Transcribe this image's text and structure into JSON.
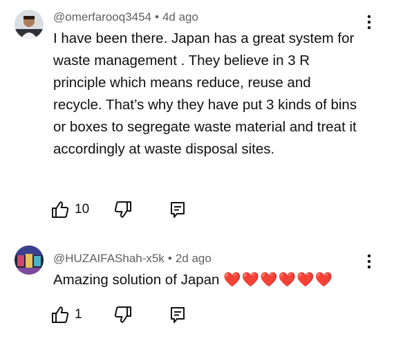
{
  "comments": [
    {
      "author": "@omerfarooq3454",
      "separator": "•",
      "time": "4d ago",
      "text": "I have been there. Japan has a great system for waste management . They believe in 3 R principle which means reduce, reuse and recycle. That’s why they have put 3 kinds of bins or boxes to segregate waste material and treat it accordingly at waste disposal sites.",
      "likes": "10",
      "icons": [
        "avatar",
        "like-icon",
        "dislike-icon",
        "reply-icon",
        "more-vert-icon"
      ]
    },
    {
      "author": "@HUZAIFAShah-x5k",
      "separator": "•",
      "time": "2d ago",
      "text": "Amazing solution of Japan",
      "emoji": "❤️❤️❤️❤️❤️❤️",
      "likes": "1",
      "icons": [
        "avatar",
        "like-icon",
        "dislike-icon",
        "reply-icon",
        "more-vert-icon"
      ]
    }
  ],
  "colors": {
    "text": "#0f0f0f",
    "meta": "#606060",
    "heart": "#e0245e"
  }
}
